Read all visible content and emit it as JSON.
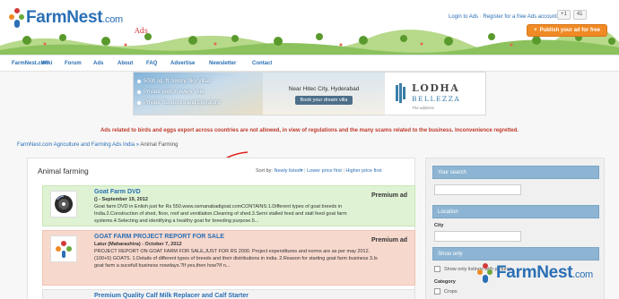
{
  "header": {
    "logo_text": "FarmNest",
    "logo_suffix": ".com",
    "logo_sub": "Ads",
    "login_link": "Login to Ads",
    "separator": "·",
    "register_link": "Register for a free Ads account",
    "gplus_label": "+1",
    "gplus_count": "41",
    "publish_label": "Publish your ad for free"
  },
  "nav": {
    "items": [
      "FarmNest.com",
      "Wiki",
      "Forum",
      "Ads",
      "About",
      "FAQ",
      "Advertise",
      "Newsletter",
      "Contact"
    ]
  },
  "banner": {
    "bullets": [
      "5000 sq. ft. luxury Sky Villas",
      "Private pool in every Villa",
      "Private Sundecks and Elevators"
    ],
    "location": "Near Hitec City, Hyderabad",
    "cta": "Book your dream villa",
    "brand": "LODHA",
    "brand_sub": "BELLEZZA",
    "brand_addr": "The address"
  },
  "warning": "Ads related to birds and eggs export across countries are not allowed, in view of regulations and the many scams related to the business. Inconvenience regretted.",
  "breadcrumb": {
    "link": "FarmNest.com Agriculture and Farming Ads India",
    "sep": "»",
    "current": "Animal Farming"
  },
  "listing": {
    "title": "Animal farming",
    "sort_prefix": "Sort by:",
    "sort_options": [
      "Newly listed",
      "Lower price first",
      "Higher price first"
    ],
    "sort_caret": "▾",
    "sort_sep": "|",
    "ads": [
      {
        "title": "Goat Farm DVD",
        "meta": "() - September 19, 2012",
        "body": "Goat farm DVD in Enlish just for Rs 550.www.osmanabadigoat.comCONTAINS:1.Different types of goat breeds in India.2.Construction of shed, floor, roof and ventilation.Cleaning of shed.3.Semi stalled feed and stall feed goat farm systems.4.Selecting and identifying a healthy goat for breeding purpose.5...",
        "badge": "Premium ad"
      },
      {
        "title": "GOAT FARM PROJECT REPORT FOR SALE",
        "meta": "Latur (Maharashtra) - October 7, 2012",
        "body": "PROJECT REPORT ON GOAT FARM FOR SALE,JUST FOR RS 2000. Project expenditures and norms are as per may 2012. (100+5) GOATS. 1.Details of different types of breeds and their distributions in india. 2.Reason for starting goat farm business 3.Is goat farm a sucefull business nowdays.?If yes,then how?If n...",
        "badge": "Premium ad"
      },
      {
        "title": "Premium Quality Calf Milk Replacer and Calf Starter",
        "meta": "",
        "body": "",
        "badge": ""
      }
    ]
  },
  "sidebar": {
    "search_header": "Your search",
    "location_header": "Location",
    "city_label": "City",
    "show_only_header": "Show only",
    "show_only_option": "Show only listings with pictures",
    "category_label": "Category",
    "category_item": "Crops"
  },
  "watermark": {
    "text": "FarmNest",
    "suffix": ".com"
  }
}
